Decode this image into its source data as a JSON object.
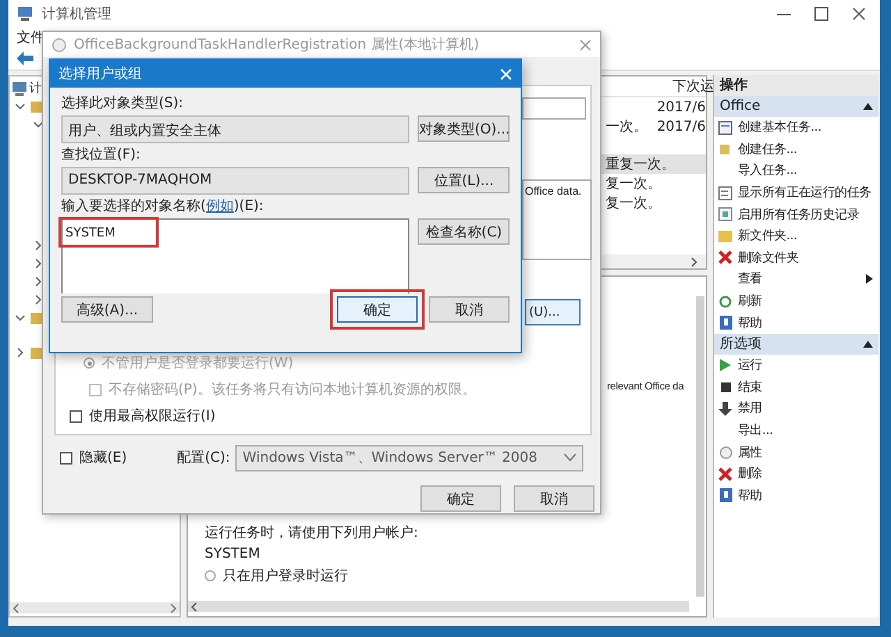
{
  "window": {
    "title": "计算机管理",
    "menu": [
      "文件"
    ]
  },
  "tree": [
    {
      "label": "计",
      "children": [
        {
          "expanded": true,
          "children": [
            {
              "expanded": true
            },
            {
              "expanded": false
            },
            {
              "expanded": false
            },
            {
              "expanded": false
            },
            {
              "expanded": false
            }
          ]
        },
        {
          "expanded": true
        },
        {
          "expanded": false
        }
      ]
    }
  ],
  "task_list": {
    "header": "下次运",
    "rows": [
      {
        "next_run": "2017/6",
        "selected": false
      },
      {
        "trigger": "一次。",
        "next_run": "2017/6",
        "selected": false
      },
      {
        "trigger": "重复一次。",
        "selected": true
      },
      {
        "trigger": "复一次。",
        "selected": false
      },
      {
        "trigger": "复一次。",
        "selected": false
      }
    ]
  },
  "details": {
    "description": "relevant Office da",
    "account_label": "运行任务时，请使用下列用户帐户:",
    "account": "SYSTEM",
    "logon_option": {
      "label": "只在用户登录时运行",
      "selected": false
    }
  },
  "actions": {
    "title": "操作",
    "sections": [
      {
        "title": "Office",
        "expanded": true,
        "items": [
          {
            "label": "创建基本任务...",
            "kind": "basic-task"
          },
          {
            "label": "创建任务...",
            "kind": "task"
          },
          {
            "label": "导入任务...",
            "kind": "none"
          },
          {
            "label": "显示所有正在运行的任务",
            "kind": "running"
          },
          {
            "label": "启用所有任务历史记录",
            "kind": "history"
          },
          {
            "label": "新文件夹...",
            "kind": "folder"
          },
          {
            "label": "删除文件夹",
            "kind": "delete"
          },
          {
            "label": "查看",
            "kind": "submenu"
          },
          {
            "label": "刷新",
            "kind": "refresh"
          },
          {
            "label": "帮助",
            "kind": "help"
          }
        ]
      },
      {
        "title": "所选项",
        "expanded": true,
        "items": [
          {
            "label": "运行",
            "kind": "run"
          },
          {
            "label": "结束",
            "kind": "end"
          },
          {
            "label": "禁用",
            "kind": "disable"
          },
          {
            "label": "导出...",
            "kind": "none"
          },
          {
            "label": "属性",
            "kind": "properties"
          },
          {
            "label": "删除",
            "kind": "delete"
          },
          {
            "label": "帮助",
            "kind": "help"
          }
        ]
      }
    ]
  },
  "properties_dialog": {
    "title": "OfficeBackgroundTaskHandlerRegistration 属性(本地计算机)",
    "description": "Office data.",
    "change_user_button": "(U)...",
    "run_option": {
      "label": "不管用户是否登录都要运行(W)",
      "selected": true
    },
    "no_password": {
      "label": "不存储密码(P)。该任务将只有访问本地计算机资源的权限。",
      "checked": false,
      "disabled": true
    },
    "highest_privileges": {
      "label": "使用最高权限运行(I)",
      "checked": false
    },
    "hidden": {
      "label": "隐藏(E)",
      "checked": false
    },
    "configure_label": "配置(C):",
    "configure_value": "Windows Vista™、Windows Server™ 2008",
    "buttons": [
      "确定",
      "取消"
    ]
  },
  "select_dialog": {
    "title": "选择用户或组",
    "object_type_label": "选择此对象类型(S):",
    "object_type_value": "用户、组或内置安全主体",
    "object_type_button": "对象类型(O)...",
    "location_label": "查找位置(F):",
    "location_value": "DESKTOP-7MAQHOM",
    "location_button": "位置(L)...",
    "names_label_start": "输入要选择的对象名称(",
    "names_link": "例如",
    "names_label_end": ")(E):",
    "names_value": "SYSTEM",
    "names_highlighted": true,
    "check_button": "检查名称(C)",
    "advanced_button": "高级(A)...",
    "ok_button": "确定",
    "ok_highlighted": true,
    "cancel_button": "取消"
  }
}
